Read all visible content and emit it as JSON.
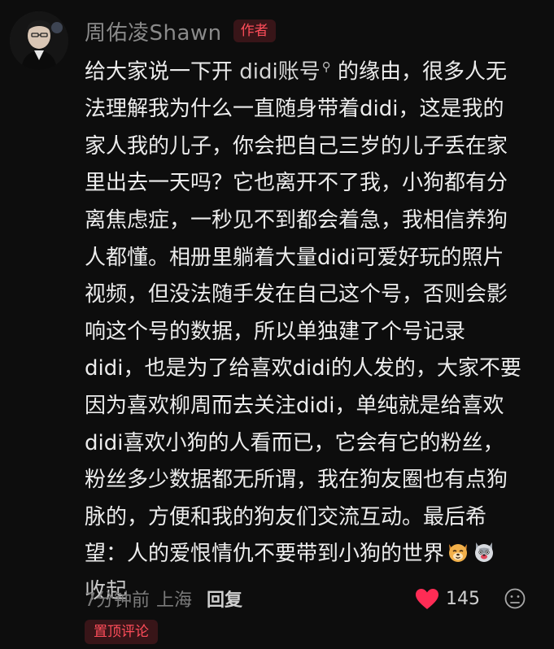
{
  "user": {
    "name": "周佑凌Shawn",
    "badge": "作者"
  },
  "comment": {
    "lines": [
      {
        "pre": "给大家说一下开 ",
        "link": "didi账号",
        "post": " 的缘由，很多人无"
      },
      {
        "text": "法理解我为什么一直随身带着didi，这是我的"
      },
      {
        "text": "家人我的儿子，你会把自己三岁的儿子丢在家"
      },
      {
        "text": "里出去一天吗？它也离开不了我，小狗都有分"
      },
      {
        "text": "离焦虑症，一秒见不到都会着急，我相信养狗"
      },
      {
        "text": "人都懂。相册里躺着大量didi可爱好玩的照片"
      },
      {
        "text": "视频，但没法随手发在自己这个号，否则会影"
      },
      {
        "text": "响这个号的数据，所以单独建了个号记录"
      },
      {
        "text": "didi，也是为了给喜欢didi的人发的，大家不要"
      },
      {
        "text": "因为喜欢柳周而去关注didi，单纯就是给喜欢"
      },
      {
        "text": "didi喜欢小狗的人看而已，它会有它的粉丝，"
      },
      {
        "text": "粉丝多少数据都无所谓，我在狗友圈也有点狗"
      },
      {
        "text": "脉的，方便和我的狗友们交流互动。最后希"
      },
      {
        "text": "望：人的爱恨情仇不要带到小狗的世界"
      }
    ],
    "collapse_label": "收起",
    "emojis": [
      "dog-face-emoji",
      "wolf-face-emoji"
    ]
  },
  "meta": {
    "time": "7分钟前",
    "location": "上海",
    "reply_label": "回复"
  },
  "actions": {
    "like_count": "145",
    "like_color": "#fe2c55"
  },
  "pin_label": "置顶评论"
}
